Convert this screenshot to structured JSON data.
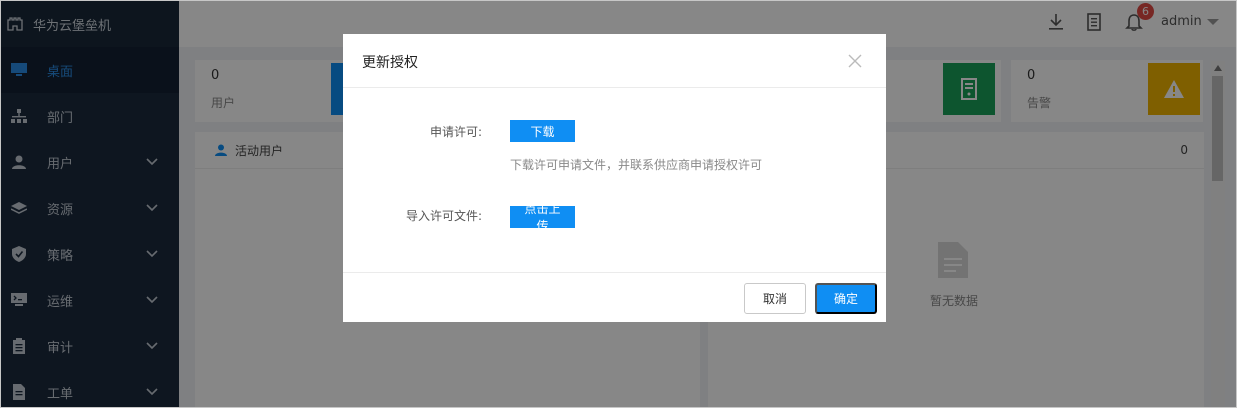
{
  "app": {
    "title": "华为云堡垒机"
  },
  "sidebar": {
    "items": [
      {
        "label": "桌面",
        "icon": "monitor-icon"
      },
      {
        "label": "部门",
        "icon": "org-tree-icon"
      },
      {
        "label": "用户",
        "icon": "user-icon"
      },
      {
        "label": "资源",
        "icon": "layers-icon"
      },
      {
        "label": "策略",
        "icon": "shield-icon"
      },
      {
        "label": "运维",
        "icon": "terminal-icon"
      },
      {
        "label": "审计",
        "icon": "clipboard-icon"
      },
      {
        "label": "工单",
        "icon": "document-icon"
      }
    ]
  },
  "header": {
    "user": "admin",
    "notification_count": "6"
  },
  "dashboard": {
    "stats": [
      {
        "value": "0",
        "label": "用户"
      },
      {
        "value": "0",
        "label": "告警"
      }
    ],
    "active_users_title": "活动用户",
    "right_panel_count": "0",
    "empty_text": "暂无数据"
  },
  "modal": {
    "title": "更新授权",
    "license_label": "申请许可:",
    "download_button": "下载",
    "hint": "下载许可申请文件，并联系供应商申请授权许可",
    "import_label": "导入许可文件:",
    "upload_button": "点击上传",
    "cancel": "取消",
    "confirm": "确定"
  },
  "colors": {
    "sidebar": "#1c2b3e",
    "accent": "#0f8ef3",
    "green": "#1aa05a",
    "yellow": "#f0b400",
    "badge": "#e14b45"
  }
}
